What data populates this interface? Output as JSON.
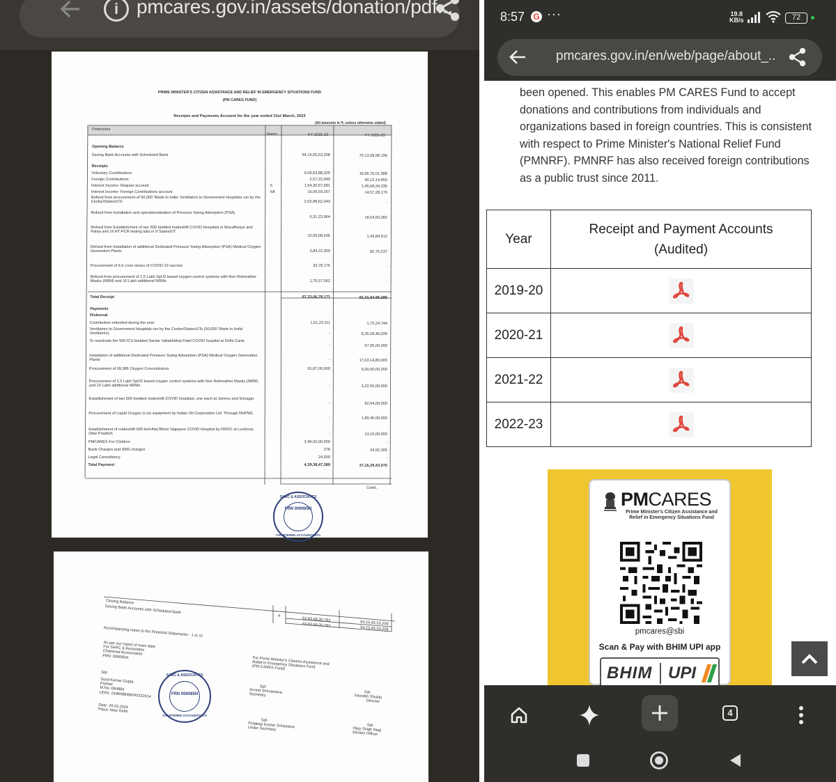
{
  "left_screen": {
    "url_text": "pmcares.gov.in/assets/donation/pdf...",
    "statement": {
      "title_line1": "PRIME MINISTER'S CITIZEN ASSISTANCE AND RELIEF IN EMERGENCY SITUATIONS FUND",
      "title_line2": "(PM CARES FUND)",
      "title_line3": "Receipts and Payments Account for the year ended 31st March, 2023",
      "amounts_note": "(All amounts in ₹, unless otherwise stated)",
      "col_particulars": "Particulars",
      "col_notes": "Notes",
      "col_fy1": "FY 2022-23",
      "col_fy2": "FY 2021-22",
      "rows": [
        {
          "label": "Opening Balance",
          "bold": true,
          "a": "",
          "b": ""
        },
        {
          "label": "Saving Bank Accounts with Scheduled Bank",
          "a": "54,15,65,53,208",
          "b": "70,13,99,98,196"
        },
        {
          "label": "Receipts",
          "bold": true,
          "a": "",
          "b": ""
        },
        {
          "label": "Voluntary Contributions",
          "a": "9,09,63,88,326",
          "b": "18,96,76,01,988"
        },
        {
          "label": "Foreign Contributions",
          "a": "2,57,22,949",
          "b": "40,12,14,459"
        },
        {
          "label": "Interest Income- Regular account",
          "note": "6",
          "a": "1,54,30,67,681",
          "b": "1,45,68,34,335"
        },
        {
          "label": "Interest Income- Foreign Contributions account",
          "note": "6A",
          "a": "16,06,93,167",
          "b": "14,57,28,176"
        },
        {
          "label": "Refund from procurement of 50,000 'Made in India' Ventilators to Government Hospitals run by the Centre/States/UTs",
          "a": "2,02,88,62,043",
          "b": "-"
        },
        {
          "label": "Refund from Installation and operationalization of Pressure Swing Adsorption (PSA)",
          "a": "5,31,23,964",
          "b": "18,54,59,382"
        },
        {
          "label": "Refund from Establishment of two 500 bedded makeshift COVID Hospitals in Muzaffarpur and Patna and 16 RT-PCR testing labs in 9 States/UT",
          "a": "10,69,08,636",
          "b": "1,43,84,512"
        },
        {
          "label": "Refund from Installation of additional Dedicated Pressure Swing Adsorption (PSA) Medical Oxygen Generation Plants",
          "a": "3,84,22,959",
          "b": "82,75,237"
        },
        {
          "label": "Procurement of 6.6 crore doses of COVID-19 vaccine",
          "a": "33,78,176",
          "b": "-"
        },
        {
          "label": "Refund from procurement of 1.5 Lakh SpO2 based oxygen control systems with Non Rebreather Masks (NRM) and 10 Lakh additional NRMs",
          "a": "1,75,57,062",
          "b": "-"
        },
        {
          "label": "Total Receipt",
          "bold": true,
          "a": "67,23,06,78,171",
          "b": "91,31,94,96,285"
        },
        {
          "label": "Payments",
          "bold": true,
          "a": "",
          "b": ""
        },
        {
          "label": "Disbursal",
          "bold": true,
          "a": "",
          "b": ""
        },
        {
          "label": "Contribution refunded during the year",
          "a": "1,51,23,111",
          "b": "1,72,24,744"
        },
        {
          "label": "Ventilators to Government Hospitals run by the Centre/States/UTs (50,000 'Made in India' Ventilators)",
          "a": "-",
          "b": "8,35,28,46,028"
        },
        {
          "label": "To reactivate the 500 ICU bedded Sardar Vallabhbhai Patel COVID hospital at Delhi Cantt.",
          "a": "-",
          "b": "67,95,00,000"
        },
        {
          "label": "Installation of additional Dedicated Pressure Swing Adsorption (PSA) Medical Oxygen Generation Plants",
          "a": "-",
          "b": "17,03,14,80,000"
        },
        {
          "label": "Procurement of 99,986 Oxygen Concentrators",
          "a": "91,87,00,000",
          "b": "5,00,00,00,000"
        },
        {
          "label": "Procurement of 1.5 Lakh SpO2 based oxygen control systems with Non Rebreather Masks (NRM) and 10 Lakh additional NRMs",
          "a": "-",
          "b": "3,22,50,00,000"
        },
        {
          "label": "Establishment of two 500 bedded makeshift COVID hospitals, one each at Jammu and Srinagar",
          "a": "-",
          "b": "82,94,00,000"
        },
        {
          "label": "Procurement of Liquid Oxygen (Lox) equipment by Indian Oil Corporation Ltd. Through MoPNG",
          "a": "-",
          "b": "1,89,40,00,000"
        },
        {
          "label": "Establishment of makeshift 500 bed Atal Bihari Vajpayee COVID Hospital by DRDO at Lucknow, Uttar Pradesh",
          "a": "-",
          "b": "13,10,00,000"
        },
        {
          "label": "PMCARES For Children",
          "a": "3,46,00,00,000",
          "b": "-"
        },
        {
          "label": "Bank Charges and SMS charges",
          "a": "278",
          "b": "24,92,305"
        },
        {
          "label": "Legal Consultancy",
          "a": "24,000",
          "b": "-"
        },
        {
          "label": "Total Payment",
          "bold": true,
          "a": "4,39,38,47,389",
          "b": "37,16,29,43,076"
        }
      ],
      "contd": "Contd..",
      "stamp1_top": "SARC & ASSOCIATES",
      "stamp1_mid": "FRN 006085N",
      "stamp1_bottom": "CHARTERED ACCOUNTANTS"
    },
    "page2": {
      "closing_balance": "Closing Balance",
      "closing_line": "Saving Bank Accounts with Scheduled Bank",
      "closing_note": "4",
      "closing_a": "62,83,68,30,782",
      "closing_a2": "62,83,68,30,782",
      "closing_b": "54,15,65,53,208",
      "closing_b2": "54,15,65,53,208",
      "accompanying": "Accompanying notes to the Financial Statements - 1 to 11",
      "auditor_lines": [
        "As per our report of even date",
        "For SARC & Associates",
        "Chartered Accountants",
        "FRN: 006085N"
      ],
      "fund_lines": [
        "For Prime Minister's Citizens Assistance and",
        "Relief in Emergency Situations Fund",
        "(PM CARES Fund)"
      ],
      "sd": "Sd/-",
      "partner_lines": [
        "Sunil Kumar Gupta",
        "Partner",
        "M.No.:084884",
        "UDIN: 24084884BKIKDZ2614"
      ],
      "secretary_lines": [
        "Arvind Shrivastava",
        "Secretary"
      ],
      "director_lines": [
        "Saurabh Shukla",
        "Director"
      ],
      "under_sec_lines": [
        "Pradeep Kumar Srivastava",
        "Under Secretary"
      ],
      "section_off_lines": [
        "Vijay Singh Negi",
        "Section Officer"
      ],
      "date_lines": [
        "Date: 29.03.2024",
        "Place: New Delhi"
      ],
      "stamp2_top": "SARC & ASSOCIATES",
      "stamp2_mid": "FRN 006085N",
      "stamp2_bottom": "CHARTERED ACCOUNTANTS"
    }
  },
  "right_screen": {
    "status": {
      "time": "8:57",
      "google": "G",
      "dots": "···",
      "net_speed": "19.8",
      "net_unit": "KB/s",
      "battery": "72"
    },
    "url_text": "pmcares.gov.in/en/web/page/about_..",
    "paragraph_lines": [
      "been opened. This enables PM CARES Fund to accept",
      "donations and contributions from individuals and",
      "organizations based in foreign countries. This is consistent",
      "with respect to Prime Minister's National Relief Fund",
      "(PMNRF). PMNRF has also received foreign contributions",
      "as a public trust since 2011."
    ],
    "table": {
      "header_year": "Year",
      "header_accounts_line1": "Receipt and Payment Accounts",
      "header_accounts_line2": "(Audited)",
      "years": [
        "2019-20",
        "2020-21",
        "2021-22",
        "2022-23"
      ]
    },
    "banner": {
      "pm": "PM",
      "cares": "CARES",
      "subtitle": "Prime Minister's Citizen Assistance and Relief in Emergency Situations Fund",
      "upi_id": "pmcares@sbi",
      "scan_text": "Scan & Pay with BHIM UPI app",
      "bhim": "BHIM",
      "upi": "UPI"
    },
    "bottom_nav": {
      "tab_count": "4"
    }
  },
  "colors": {
    "adobe_red": "#e0443a",
    "banner_yellow": "#efc630",
    "dark_chrome": "#2f2e2b"
  }
}
